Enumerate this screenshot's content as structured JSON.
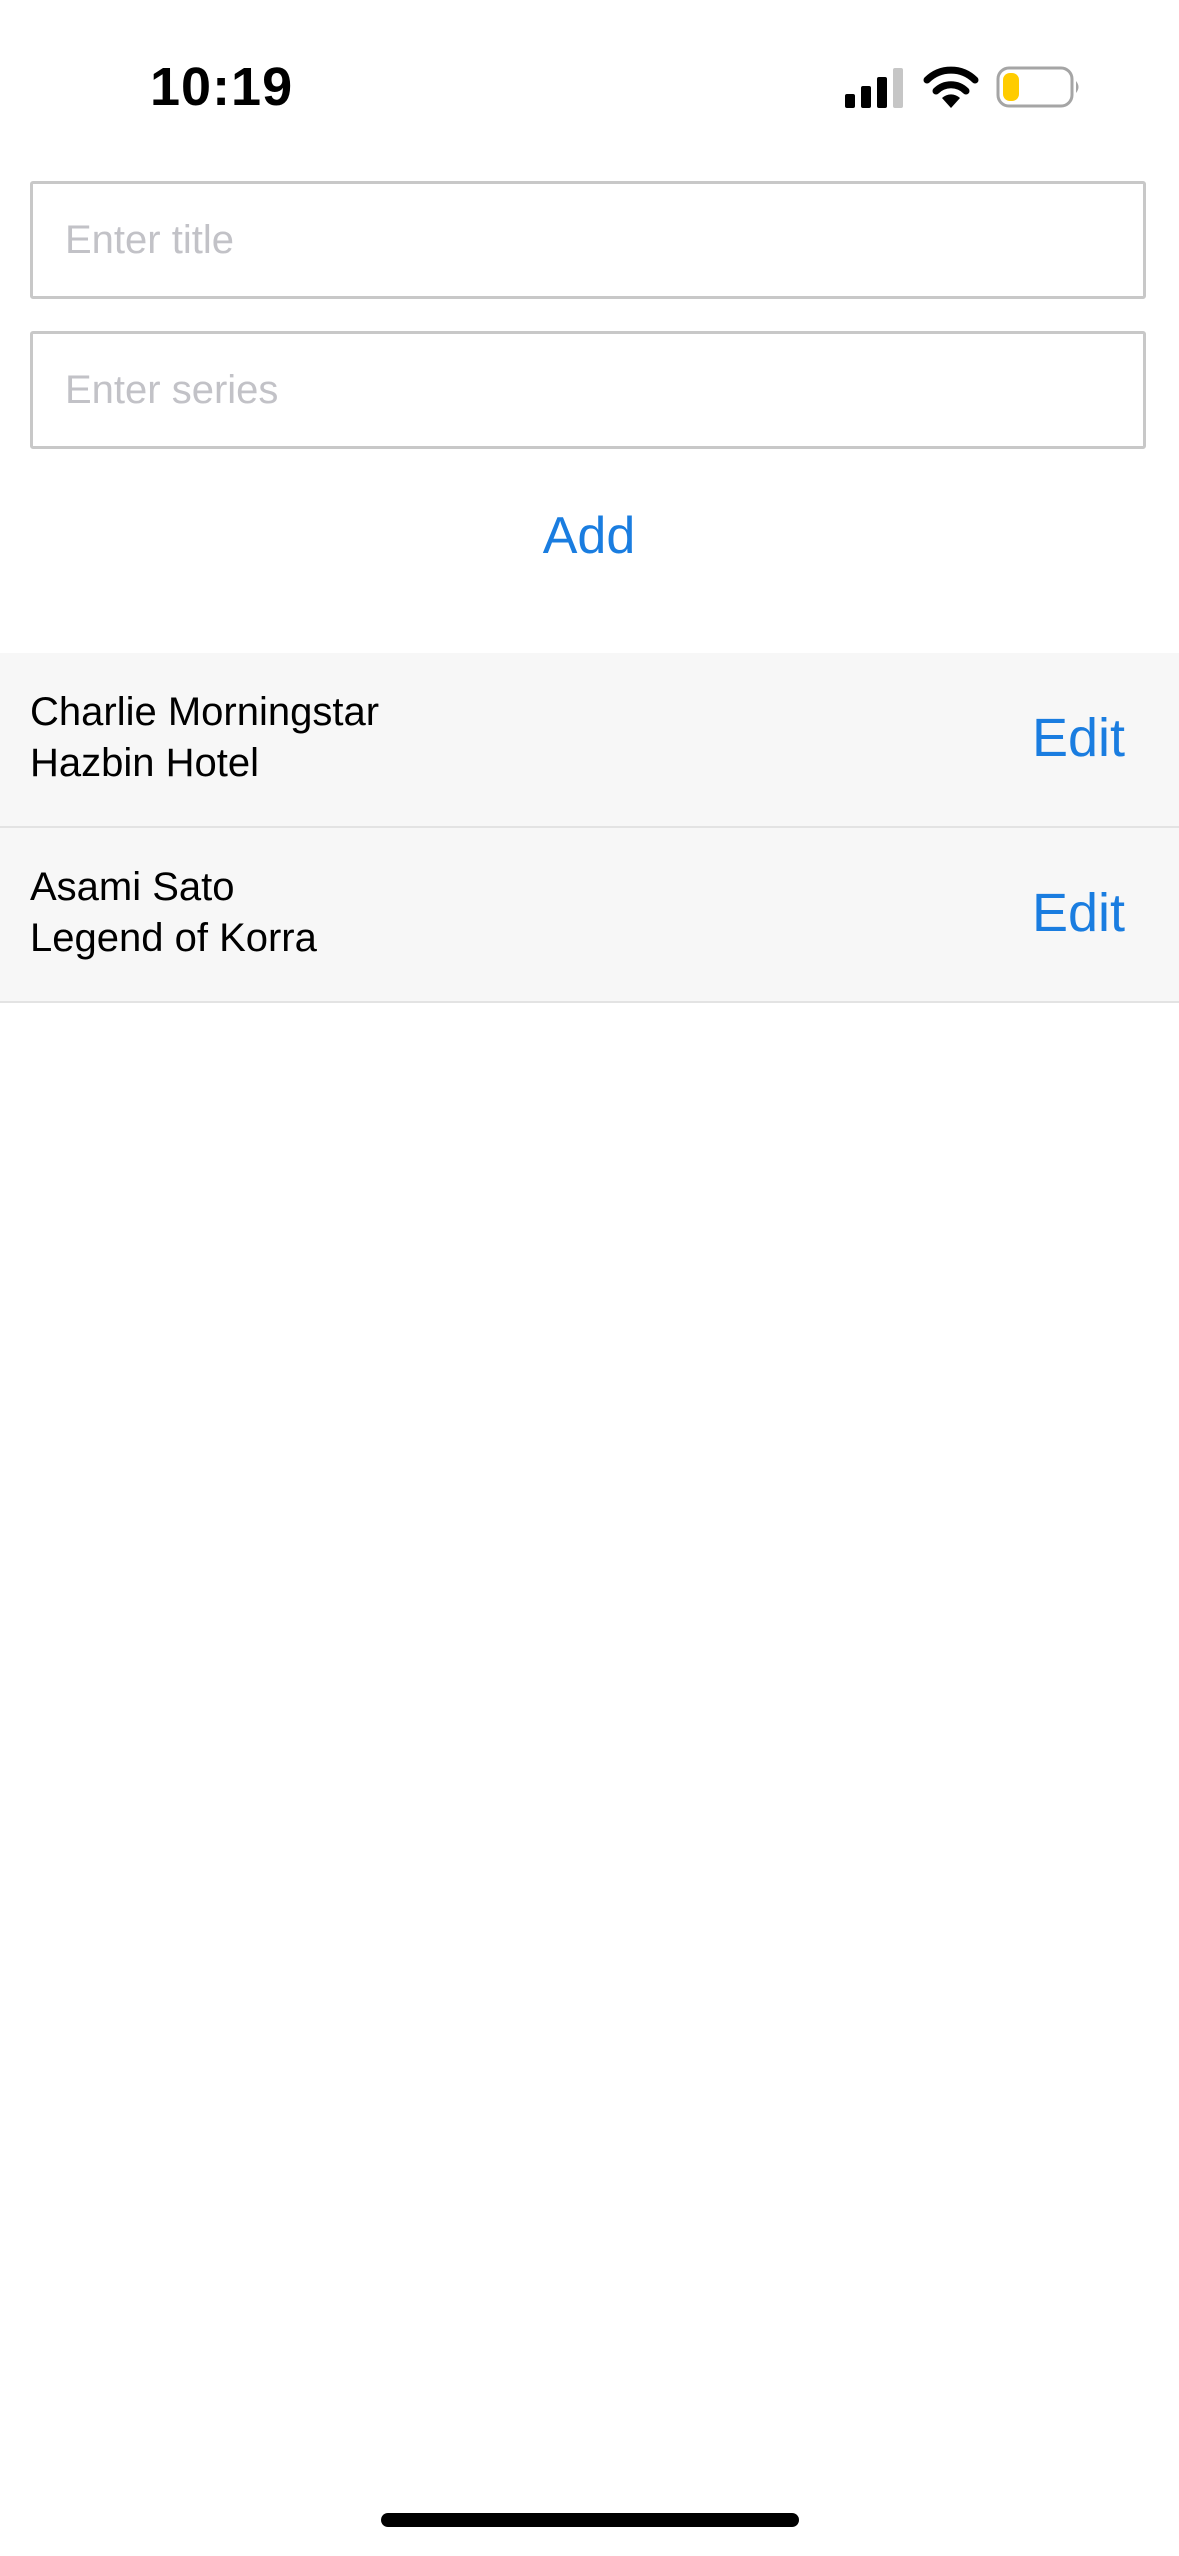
{
  "status_bar": {
    "time": "10:19",
    "signal_icon": "cellular-signal-icon",
    "wifi_icon": "wifi-icon",
    "battery_icon": "battery-icon",
    "battery_level": 0.25,
    "battery_fill_color": "#ffcc00"
  },
  "form": {
    "title_placeholder": "Enter title",
    "title_value": "",
    "series_placeholder": "Enter series",
    "series_value": "",
    "add_label": "Add"
  },
  "list": {
    "items": [
      {
        "title": "Charlie Morningstar",
        "series": "Hazbin Hotel",
        "edit_label": "Edit"
      },
      {
        "title": "Asami Sato",
        "series": "Legend of Korra",
        "edit_label": "Edit"
      }
    ]
  },
  "colors": {
    "accent": "#1a7de0",
    "row_background": "#f7f7f7",
    "placeholder": "#c2c2c7"
  }
}
